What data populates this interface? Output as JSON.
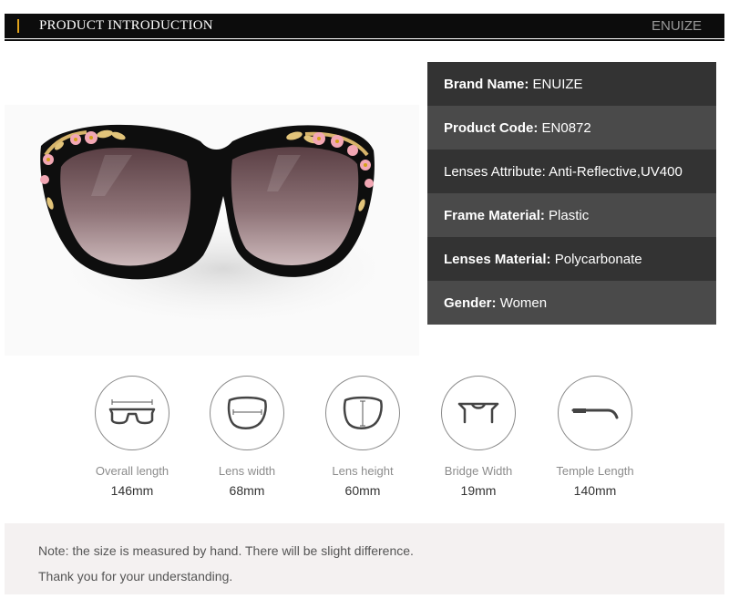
{
  "header": {
    "title": "PRODUCT INTRODUCTION",
    "brand": "ENUIZE"
  },
  "specs": [
    {
      "key": "Brand Name:",
      "value": "ENUIZE"
    },
    {
      "key": "Product Code:",
      "value": "EN0872"
    },
    {
      "key": "",
      "value": "Lenses Attribute: Anti-Reflective,UV400"
    },
    {
      "key": "Frame Material:",
      "value": "Plastic"
    },
    {
      "key": "Lenses Material:",
      "value": "Polycarbonate"
    },
    {
      "key": "Gender:",
      "value": "Women"
    }
  ],
  "measurements": [
    {
      "label": "Overall length",
      "value": "146mm",
      "icon": "overall-length-icon"
    },
    {
      "label": "Lens width",
      "value": "68mm",
      "icon": "lens-width-icon"
    },
    {
      "label": "Lens height",
      "value": "60mm",
      "icon": "lens-height-icon"
    },
    {
      "label": "Bridge Width",
      "value": "19mm",
      "icon": "bridge-width-icon"
    },
    {
      "label": "Temple Length",
      "value": "140mm",
      "icon": "temple-length-icon"
    }
  ],
  "note": {
    "line1": "Note: the size is measured by hand. There will be slight difference.",
    "line2": "Thank you for your understanding."
  },
  "colors": {
    "header_bg": "#0c0c0c",
    "accent": "#e0a21c",
    "spec_dark": "#333333",
    "spec_light": "#4a4a4a",
    "note_bg": "#f4f1f1"
  }
}
